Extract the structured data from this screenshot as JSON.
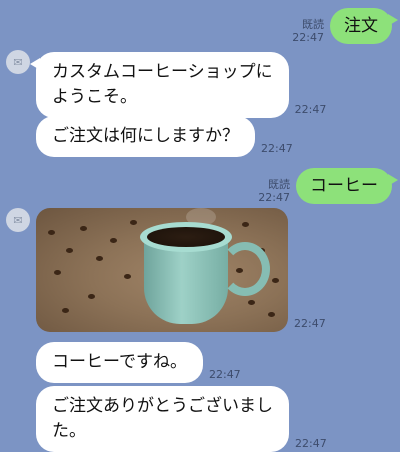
{
  "messages": [
    {
      "from": "user",
      "read": "既読",
      "time": "22:47",
      "text": "注文"
    },
    {
      "from": "bot",
      "time": "22:47",
      "lines": [
        "カスタムコーヒーショップに",
        "ようこそ。"
      ]
    },
    {
      "from": "bot",
      "time": "22:47",
      "text": "ご注文は何にしますか？"
    },
    {
      "from": "user",
      "read": "既読",
      "time": "22:47",
      "text": "コーヒー"
    },
    {
      "from": "bot",
      "time": "22:47",
      "image": "coffee-cup-photo"
    },
    {
      "from": "bot",
      "time": "22:47",
      "text": "コーヒーですね。"
    },
    {
      "from": "bot",
      "time": "22:47",
      "lines": [
        "ご注文ありがとうございまし",
        "た。"
      ]
    }
  ],
  "colors": {
    "background": "#7c94c4",
    "outgoing_bubble": "#8de17a",
    "incoming_bubble": "#ffffff"
  }
}
